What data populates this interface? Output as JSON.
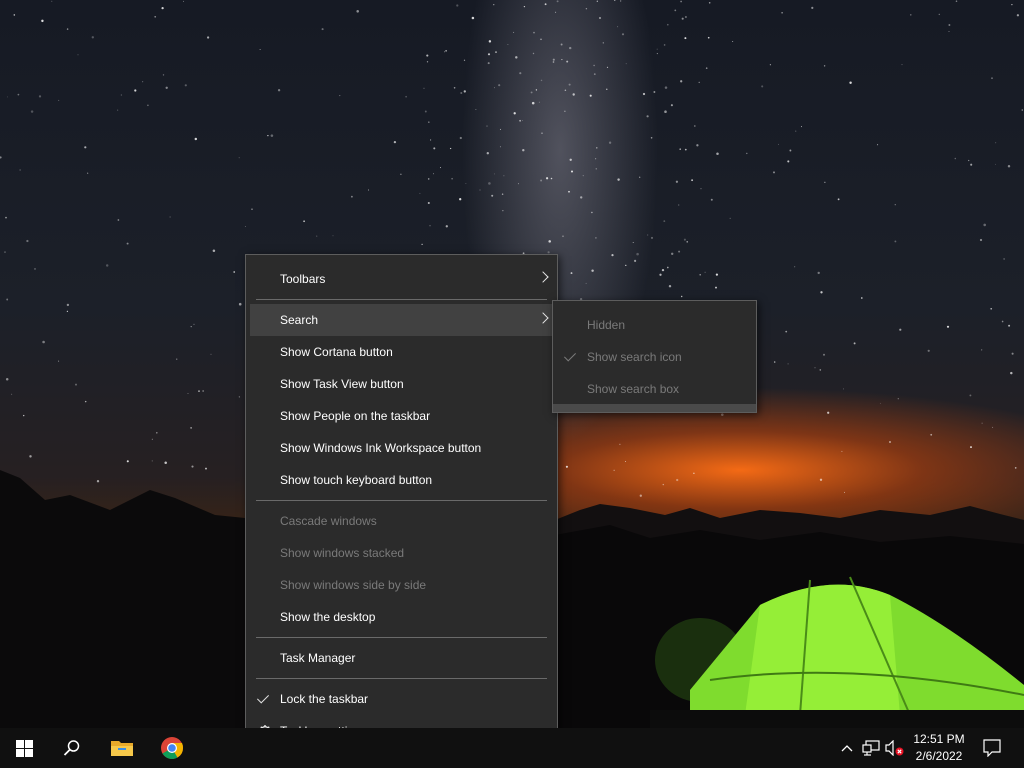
{
  "context_menu": {
    "toolbars": "Toolbars",
    "search": "Search",
    "show_cortana": "Show Cortana button",
    "show_task_view": "Show Task View button",
    "show_people": "Show People on the taskbar",
    "show_ink": "Show Windows Ink Workspace button",
    "show_touch_keyboard": "Show touch keyboard button",
    "cascade": "Cascade windows",
    "stacked": "Show windows stacked",
    "side_by_side": "Show windows side by side",
    "show_desktop": "Show the desktop",
    "task_manager": "Task Manager",
    "lock_taskbar": "Lock the taskbar",
    "taskbar_settings": "Taskbar settings"
  },
  "search_submenu": {
    "hidden": "Hidden",
    "show_icon": "Show search icon",
    "show_box": "Show search box",
    "selected": "Show search icon"
  },
  "taskbar": {
    "time": "12:51 PM",
    "date": "2/6/2022",
    "icons": [
      "windows-start-icon",
      "search-icon",
      "file-explorer-icon",
      "chrome-icon"
    ],
    "tray_icons": [
      "chevron-up-icon",
      "network-icon",
      "volume-muted-icon",
      "notification-icon"
    ]
  },
  "colors": {
    "menu_bg": "#2b2b2b",
    "menu_hover": "#414141",
    "disabled_text": "#7a7a7a",
    "taskbar_bg": "#101010",
    "start_blue": "#ffffff"
  }
}
